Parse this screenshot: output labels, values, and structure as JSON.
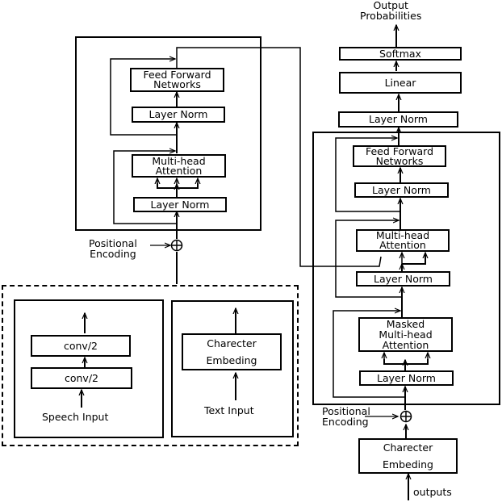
{
  "encoder": {
    "feed_forward": "Feed Forward\nNetworks",
    "layer_norm_top": "Layer Norm",
    "attention": "Multi-head\nAttention",
    "layer_norm_bottom": "Layer Norm",
    "positional_encoding": "Positional\nEncoding"
  },
  "input_frontend": {
    "speech": {
      "conv_top": "conv/2",
      "conv_bottom": "conv/2",
      "input_label": "Speech Input"
    },
    "text": {
      "embedding": "Charecter\nEmbeding",
      "input_label": "Text Input"
    }
  },
  "decoder": {
    "output_label": "Output\nProbabilities",
    "softmax": "Softmax",
    "linear": "Linear",
    "final_layer_norm": "Layer Norm",
    "feed_forward": "Feed Forward\nNetworks",
    "layer_norm_ff": "Layer Norm",
    "cross_attention": "Multi-head\nAttention",
    "layer_norm_cross": "Layer Norm",
    "masked_attention": "Masked\nMulti-head\nAttention",
    "layer_norm_masked": "Layer Norm",
    "positional_encoding": "Positional\nEncoding",
    "embedding": "Charecter\nEmbeding",
    "input_label": "outputs"
  }
}
